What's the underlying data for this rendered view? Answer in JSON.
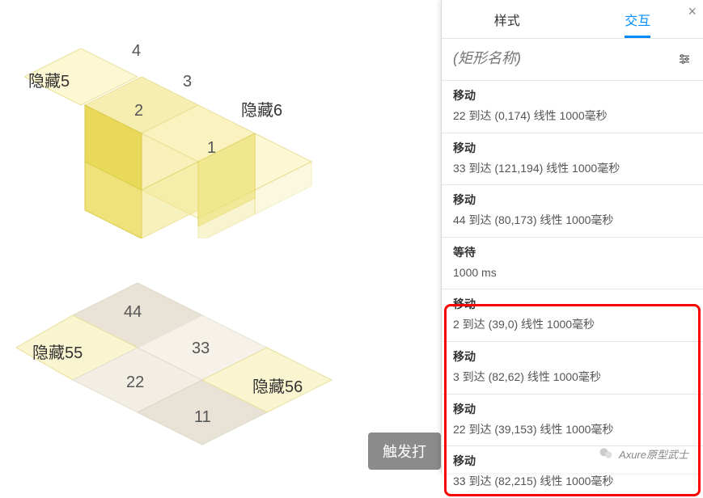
{
  "canvas": {
    "labels_top": {
      "t1": "1",
      "t2": "2",
      "t3": "3",
      "t4": "4"
    },
    "hide_top": {
      "h5": "隐藏5",
      "h6": "隐藏6"
    },
    "labels_bottom": {
      "t11": "11",
      "t22": "22",
      "t33": "33",
      "t44": "44"
    },
    "hide_bottom": {
      "h55": "隐藏55",
      "h56": "隐藏56"
    },
    "floating_button": "触发打"
  },
  "panel": {
    "tabs": {
      "style": "样式",
      "interact": "交互"
    },
    "name_placeholder": "(矩形名称)",
    "actions": [
      {
        "title": "移动",
        "desc": "22 到达 (0,174) 线性 1000毫秒"
      },
      {
        "title": "移动",
        "desc": "33 到达 (121,194) 线性 1000毫秒"
      },
      {
        "title": "移动",
        "desc": "44 到达 (80,173) 线性 1000毫秒"
      },
      {
        "title": "等待",
        "desc": "1000 ms"
      },
      {
        "title": "移动",
        "desc": "2 到达 (39,0) 线性 1000毫秒"
      },
      {
        "title": "移动",
        "desc": "3 到达 (82,62) 线性 1000毫秒"
      },
      {
        "title": "移动",
        "desc": "22 到达 (39,153) 线性 1000毫秒"
      },
      {
        "title": "移动",
        "desc": "33 到达 (82,215) 线性 1000毫秒"
      }
    ]
  },
  "watermark": {
    "text": "Axure原型武士"
  },
  "colors": {
    "tile_top": "#f6eeb0",
    "tile_stroke": "#e8df96",
    "tile_left": "#e8d95a",
    "tile_right": "#f1e78f",
    "flat_dark": "#e8e3d6",
    "flat_light": "#f6f2ea"
  }
}
